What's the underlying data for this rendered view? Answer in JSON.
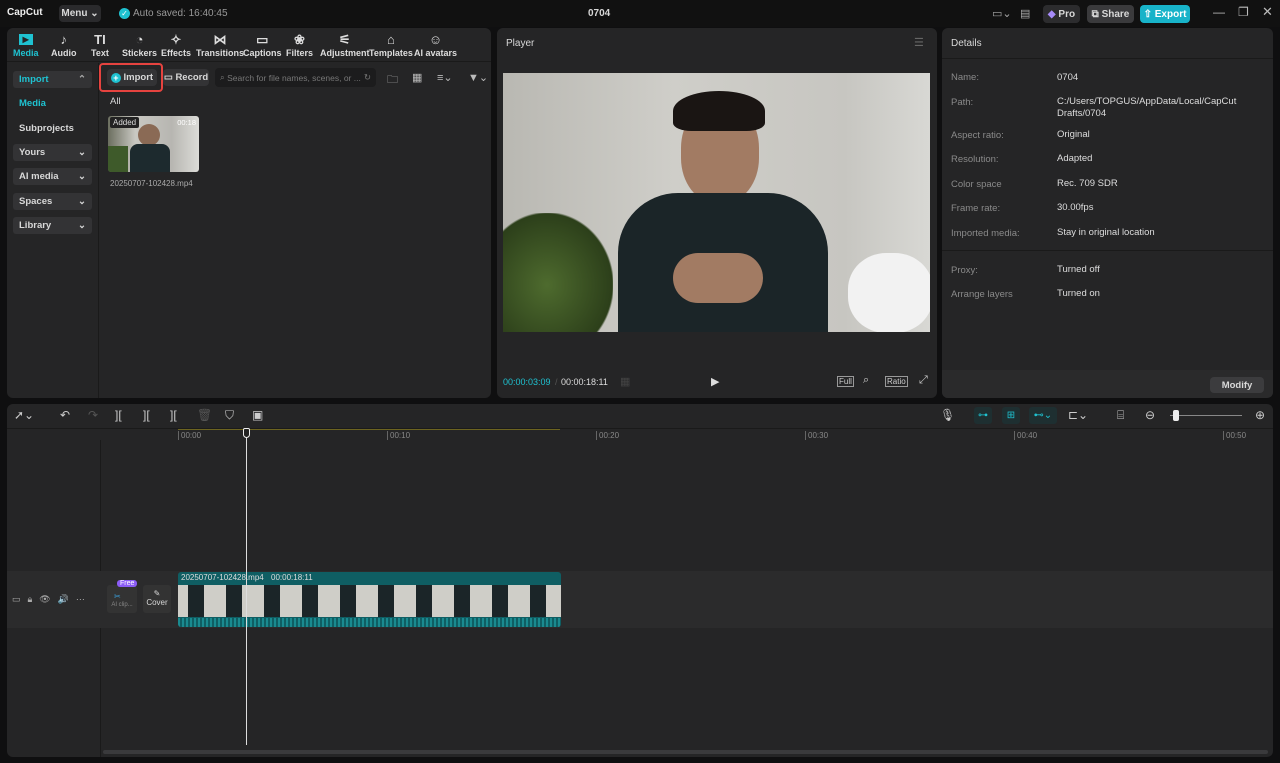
{
  "app": {
    "logo": "CapCut",
    "menu": "Menu",
    "autosave": "Auto saved: 16:40:45",
    "project_title": "0704",
    "pro": "Pro",
    "share": "Share",
    "export": "Export"
  },
  "toolbar_tabs": [
    {
      "label": "Media",
      "icon": "▶"
    },
    {
      "label": "Audio",
      "icon": "♪"
    },
    {
      "label": "Text",
      "icon": "TI"
    },
    {
      "label": "Stickers",
      "icon": "◔"
    },
    {
      "label": "Effects",
      "icon": "✧"
    },
    {
      "label": "Transitions",
      "icon": "⋈"
    },
    {
      "label": "Captions",
      "icon": "▭"
    },
    {
      "label": "Filters",
      "icon": "❀"
    },
    {
      "label": "Adjustment",
      "icon": "⚟"
    },
    {
      "label": "Templates",
      "icon": "⌂"
    },
    {
      "label": "AI avatars",
      "icon": "☺"
    }
  ],
  "sidebar": {
    "import": "Import",
    "media": "Media",
    "subprojects": "Subprojects",
    "yours": "Yours",
    "ai_media": "AI media",
    "spaces": "Spaces",
    "library": "Library"
  },
  "media": {
    "import_btn": "Import",
    "record_btn": "Record",
    "search_placeholder": "Search for file names, scenes, or ...",
    "filter_all": "All",
    "item": {
      "badge": "Added",
      "duration": "00:18",
      "name": "20250707-102428.mp4"
    }
  },
  "player": {
    "title": "Player",
    "current_time": "00:00:03:09",
    "separator": "/",
    "total_time": "00:00:18:11",
    "full": "Full",
    "ratio": "Ratio"
  },
  "details": {
    "title": "Details",
    "rows": [
      {
        "label": "Name:",
        "value": "0704"
      },
      {
        "label": "Path:",
        "value": "C:/Users/TOPGUS/AppData/Local/CapCut Drafts/0704"
      },
      {
        "label": "Aspect ratio:",
        "value": "Original"
      },
      {
        "label": "Resolution:",
        "value": "Adapted"
      },
      {
        "label": "Color space",
        "value": "Rec. 709 SDR"
      },
      {
        "label": "Frame rate:",
        "value": "30.00fps"
      },
      {
        "label": "Imported media:",
        "value": "Stay in original location"
      },
      {
        "label": "Proxy:",
        "value": "Turned off"
      },
      {
        "label": "Arrange layers",
        "value": "Turned on"
      }
    ],
    "modify": "Modify"
  },
  "timeline": {
    "ticks": [
      "00:00",
      "00:10",
      "00:20",
      "00:30",
      "00:40",
      "00:50"
    ],
    "clip_name": "20250707-102428.mp4",
    "clip_duration": "00:00:18:11",
    "free_badge": "Free",
    "ai_clip": "AI clip...",
    "cover": "Cover"
  },
  "colors": {
    "accent": "#1fc2d1",
    "export": "#18b3c9",
    "highlight": "#e6433f"
  }
}
